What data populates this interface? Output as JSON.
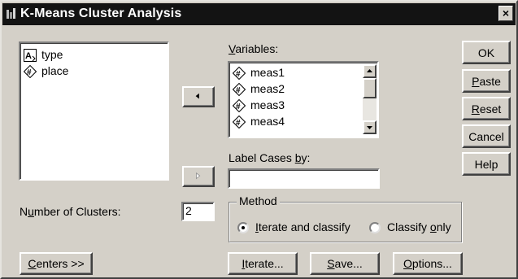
{
  "window": {
    "title": "K-Means Cluster Analysis",
    "close_glyph": "×"
  },
  "source_list": {
    "items": [
      {
        "label": "type",
        "icon": "string-variable-icon"
      },
      {
        "label": "place",
        "icon": "numeric-variable-icon"
      }
    ]
  },
  "variables": {
    "label": "Variables:",
    "mnemonic": "V",
    "rest": "ariables:",
    "items": [
      "meas1",
      "meas2",
      "meas3",
      "meas4"
    ]
  },
  "label_cases": {
    "pre": "Label Cases ",
    "mnemonic": "b",
    "post": "y:",
    "value": ""
  },
  "clusters": {
    "pre": "N",
    "mnemonic": "u",
    "post": "mber of Clusters:",
    "value": "2"
  },
  "method": {
    "title": "Method",
    "options": [
      {
        "pre": "",
        "mnemonic": "I",
        "post": "terate and classify",
        "selected": true
      },
      {
        "pre": "Classify ",
        "mnemonic": "o",
        "post": "nly",
        "selected": false
      }
    ]
  },
  "buttons": {
    "ok": "OK",
    "paste": {
      "mnemonic": "P",
      "rest": "aste"
    },
    "reset": {
      "mnemonic": "R",
      "rest": "eset"
    },
    "cancel": "Cancel",
    "help": "Help",
    "centers": {
      "mnemonic": "C",
      "rest": "enters >>"
    },
    "iterate": {
      "mnemonic": "I",
      "rest": "terate..."
    },
    "save": {
      "mnemonic": "S",
      "rest": "ave..."
    },
    "options": {
      "mnemonic": "O",
      "rest": "ptions..."
    }
  }
}
